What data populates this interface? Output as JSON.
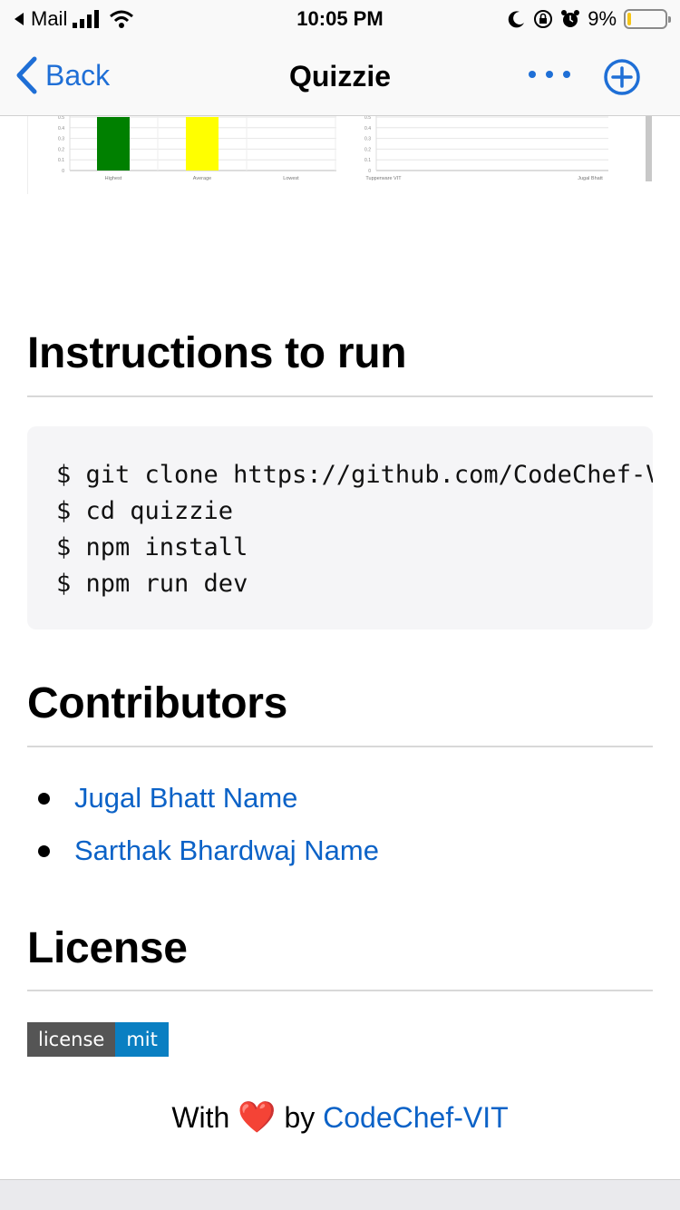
{
  "status_bar": {
    "app_back": "Mail",
    "time": "10:05 PM",
    "battery_percent": "9%",
    "battery_level": 0.09
  },
  "nav": {
    "back_label": "Back",
    "title": "Quizzie"
  },
  "chart_data": [
    {
      "type": "bar",
      "categories": [
        "Highest",
        "Average",
        "Lowest"
      ],
      "values": [
        0.5,
        0.5,
        0
      ],
      "colors": [
        "#008000",
        "#ffff00",
        "#cccccc"
      ],
      "yticks": [
        "0.5",
        "0.4",
        "0.3",
        "0.2",
        "0.1",
        "0"
      ],
      "ylim": [
        0,
        0.5
      ]
    },
    {
      "type": "bar",
      "categories": [
        "Tupperware VIT",
        "Jugal Bhatt"
      ],
      "values": [
        0,
        0
      ],
      "yticks": [
        "0.5",
        "0.4",
        "0.3",
        "0.2",
        "0.1",
        "0"
      ],
      "ylim": [
        0,
        0.5
      ]
    }
  ],
  "sections": {
    "instructions_title": "Instructions to run",
    "contributors_title": "Contributors",
    "license_title": "License"
  },
  "code_lines": [
    "$ git clone https://github.com/CodeChef-VIT/quizzie",
    "$ cd quizzie",
    "$ npm install",
    "$ npm run dev"
  ],
  "contributors": [
    "Jugal Bhatt Name",
    "Sarthak Bhardwaj Name"
  ],
  "license_badge": {
    "left": "license",
    "right": "mit"
  },
  "footer": {
    "prefix": "With",
    "heart": "❤️",
    "middle": "by",
    "link": "CodeChef-VIT"
  },
  "colors": {
    "link": "#0b62c7",
    "ios_blue": "#1f6fd6",
    "badge_left": "#555555",
    "badge_right": "#0a7fc2"
  }
}
